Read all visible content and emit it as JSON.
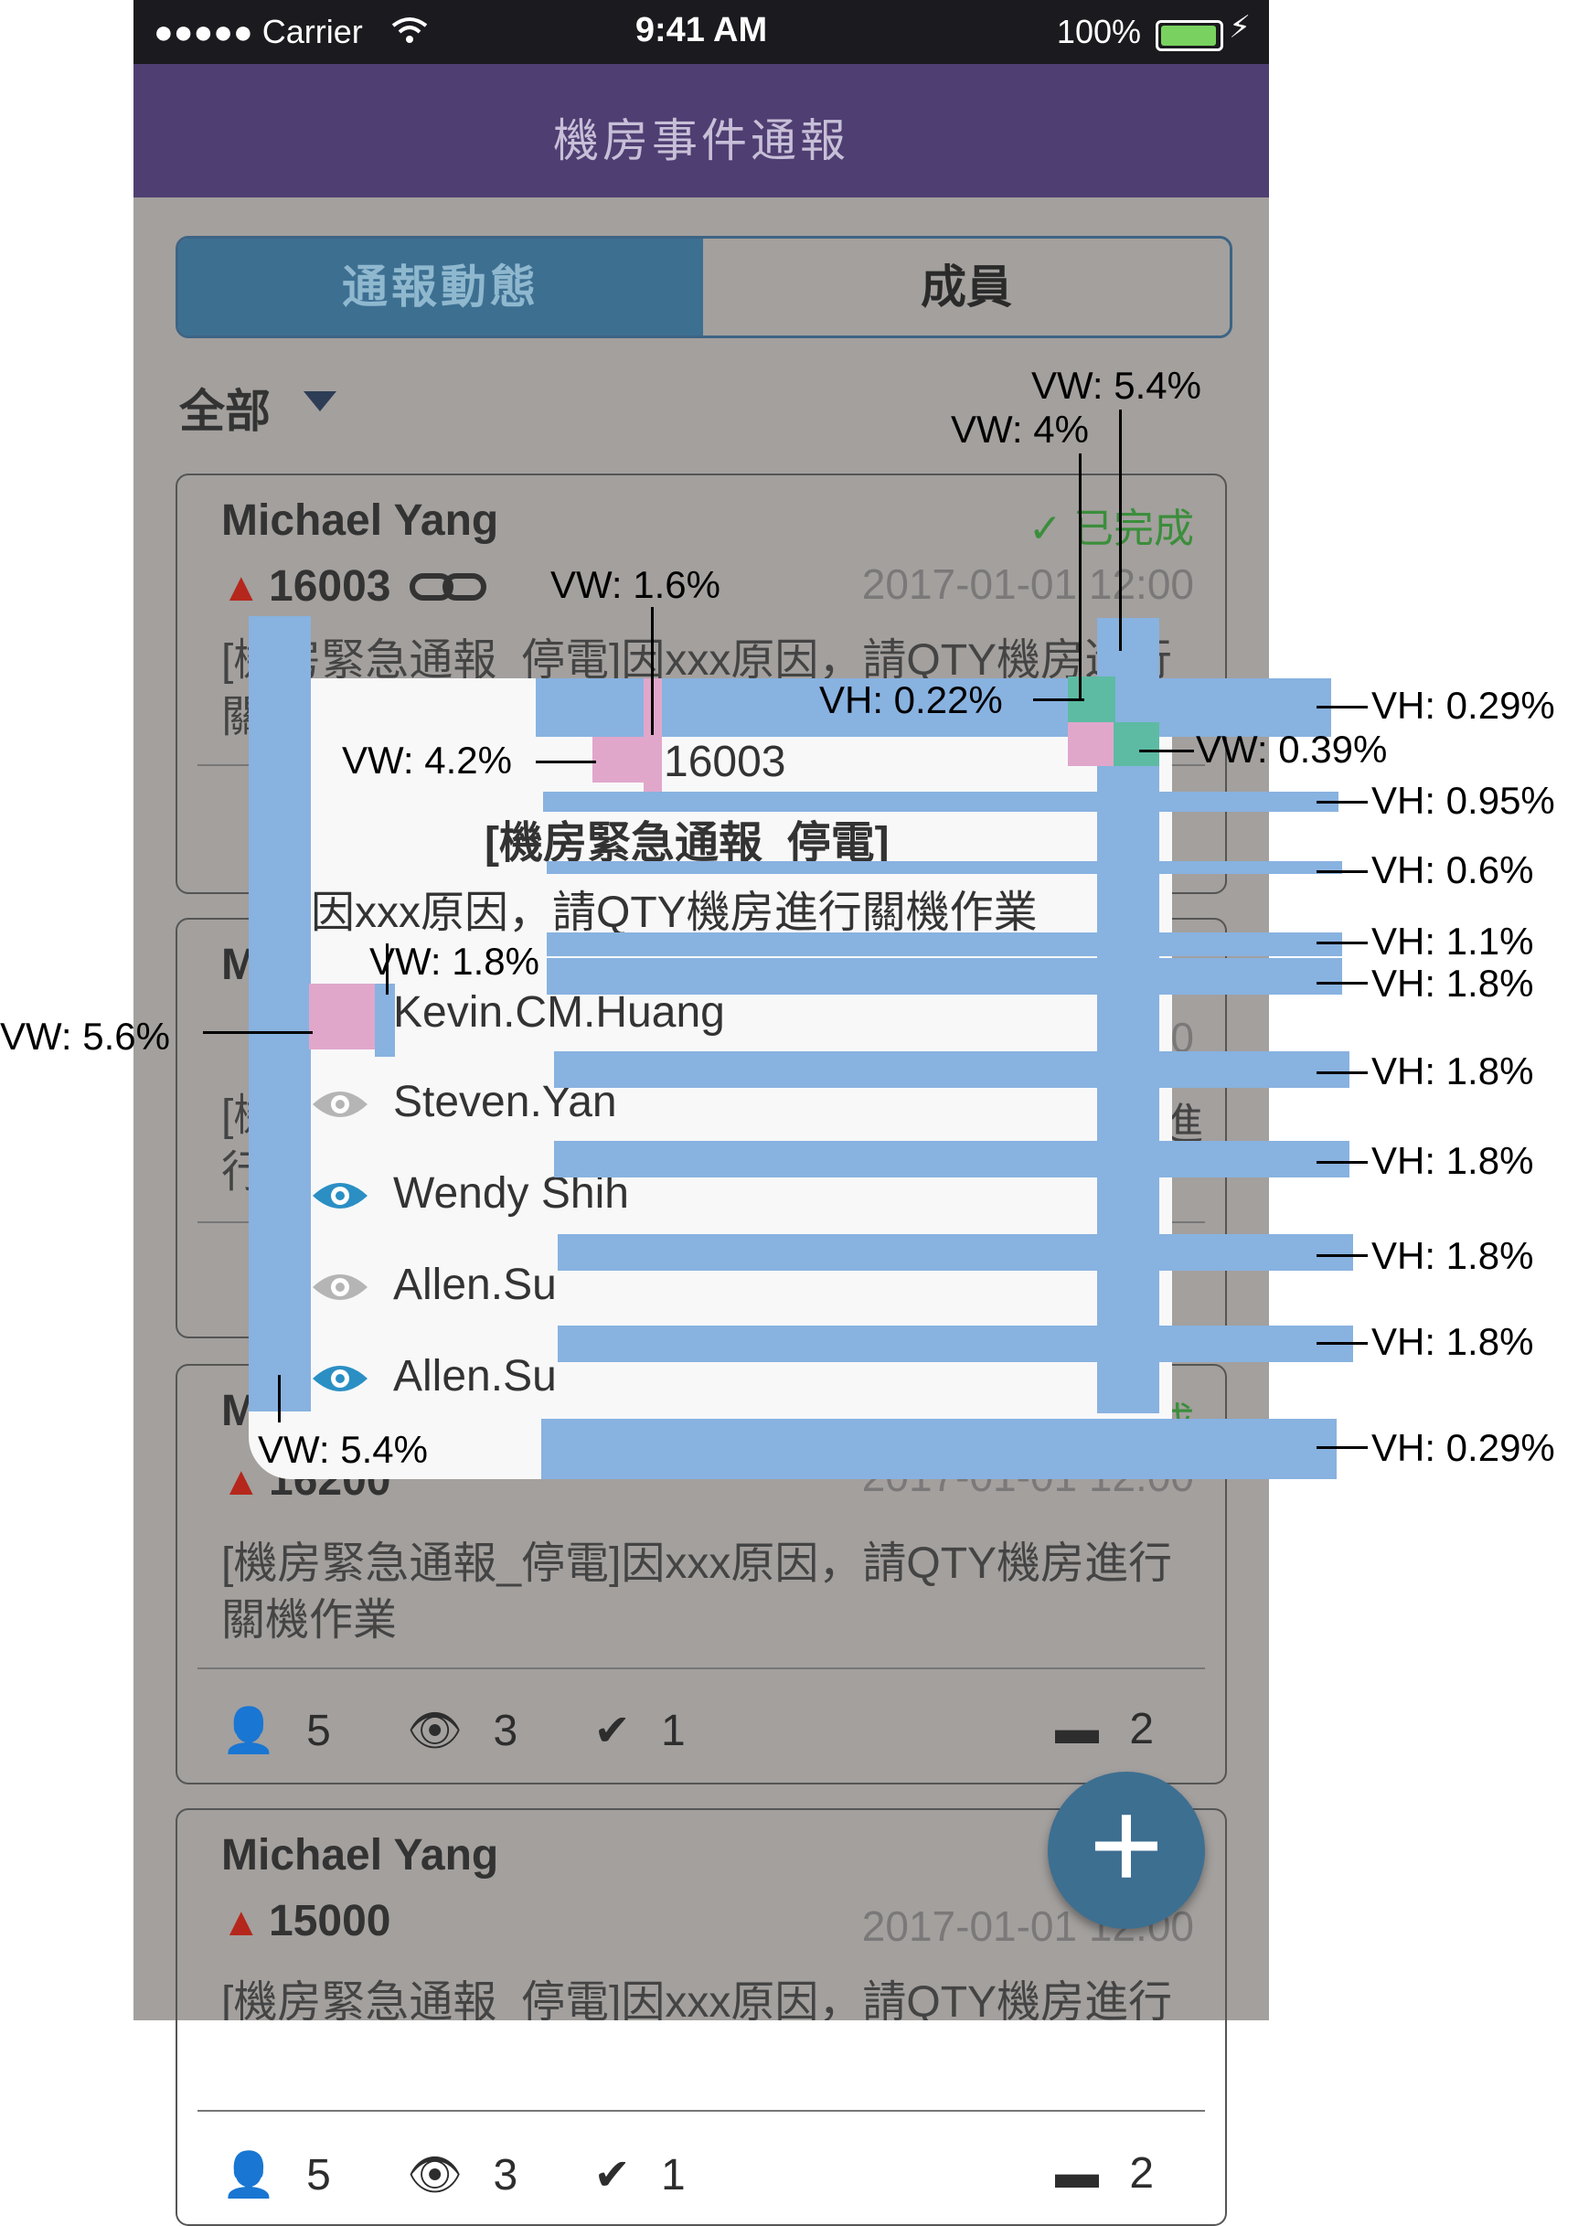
{
  "status_bar": {
    "carrier": "●●●●● Carrier",
    "time": "9:41 AM",
    "battery": "100%"
  },
  "nav": {
    "title": "機房事件通報"
  },
  "segment": {
    "tabs": [
      "通報動態",
      "成員"
    ],
    "selected": "通報動態"
  },
  "filter": {
    "label": "全部"
  },
  "cards": [
    {
      "name": "Michael Yang",
      "status": "已完成",
      "id": "16003",
      "time": "2017-01-01 12:00",
      "message": "[機房緊急通報_停電]因xxx原因，請QTY機房進行關機作業"
    },
    {
      "name": "M",
      "id": "",
      "time": "00",
      "message_fragment": "[機",
      "message_fragment2": "行",
      "side_text": "進"
    },
    {
      "name": "M",
      "status": "成",
      "id": "16200",
      "time": "2017-01-01 12:00",
      "message": "[機房緊急通報_停電]因xxx原因，請QTY機房進行關機作業",
      "stats": {
        "members": "5",
        "viewed": "3",
        "done": "1",
        "comments": "2"
      }
    },
    {
      "name": "Michael Yang",
      "id": "15000",
      "time": "2017-01-01 12:00",
      "message": "[機房緊急通報_停電]因xxx原因，請QTY機房進行關機作業",
      "stats": {
        "members": "5",
        "viewed": "3",
        "done": "1",
        "comments": "2"
      }
    }
  ],
  "popup": {
    "id": "16003",
    "title": "[機房緊急通報_停電]",
    "message": "因xxx原因，請QTY機房進行關機作業",
    "viewers": [
      {
        "name": "Kevin.CM.Huang",
        "viewed": false
      },
      {
        "name": "Steven.Yan",
        "viewed": false
      },
      {
        "name": "Wendy Shih",
        "viewed": true
      },
      {
        "name": "Allen.Su",
        "viewed": false
      },
      {
        "name": "Allen.Su",
        "viewed": true
      }
    ]
  },
  "annotations": {
    "vw_54_top": "VW: 5.4%",
    "vw_4": "VW: 4%",
    "vw_16": "VW: 1.6%",
    "vh_022": "VH: 0.22%",
    "vh_029_top": "VH: 0.29%",
    "vw_039": "VW: 0.39%",
    "vw_42": "VW: 4.2%",
    "vh_095": "VH: 0.95%",
    "vh_06": "VH: 0.6%",
    "vh_11": "VH: 1.1%",
    "vw_18": "VW: 1.8%",
    "vh_18_a": "VH: 1.8%",
    "vw_56": "VW: 5.6%",
    "vh_18_b": "VH: 1.8%",
    "vh_18_c": "VH: 1.8%",
    "vh_18_d": "VH: 1.8%",
    "vh_18_e": "VH: 1.8%",
    "vw_54_bottom": "VW: 5.4%",
    "vh_029_bottom": "VH: 0.29%"
  },
  "colors": {
    "nav": "#4f3e72",
    "segment_active": "#3d6f91",
    "annotation_bar": "#88b2e0",
    "annotation_pink": "#e0a7cb",
    "annotation_teal": "#5dbba3",
    "viewed_eye": "#2b8fc4",
    "unviewed_eye": "#b5b5b5"
  }
}
